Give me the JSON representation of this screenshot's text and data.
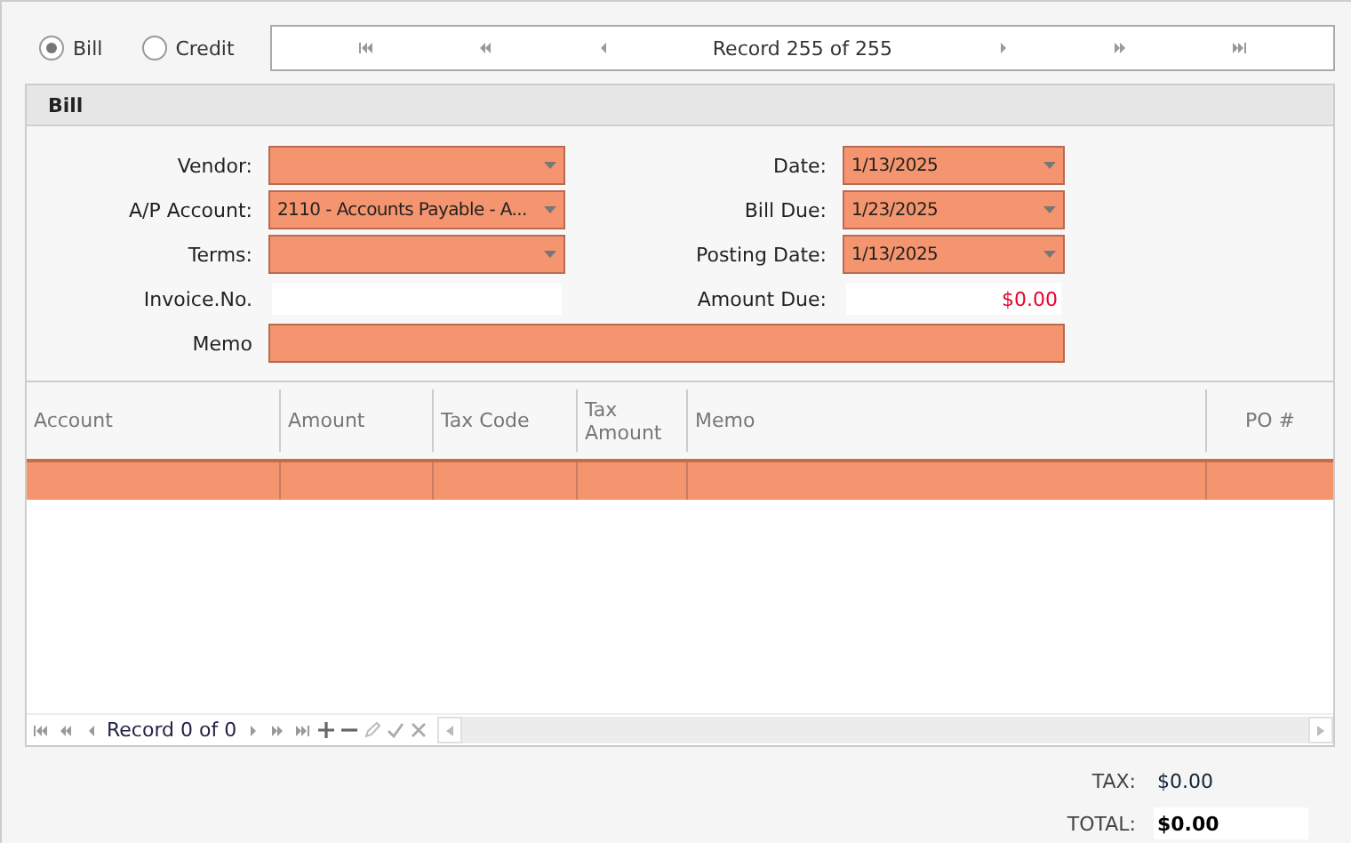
{
  "record_type": [
    {
      "label": "Bill",
      "selected": true
    },
    {
      "label": "Credit",
      "selected": false
    }
  ],
  "navigator": {
    "text": "Record 255 of 255"
  },
  "panel": {
    "title": "Bill"
  },
  "fields_left": [
    {
      "label": "Vendor:",
      "kind": "combo",
      "highlighted": true
    },
    {
      "label": "A/P Account:",
      "kind": "combo",
      "value": "2110 - Accounts Payable - A...",
      "highlighted": true
    },
    {
      "label": "Terms:",
      "kind": "combo",
      "highlighted": true
    },
    {
      "label": "Invoice.No.",
      "kind": "text",
      "highlighted": false
    }
  ],
  "fields_right": [
    {
      "label": "Date:",
      "kind": "combo",
      "value": "1/13/2025",
      "highlighted": true
    },
    {
      "label": "Bill Due:",
      "kind": "combo",
      "value": "1/23/2025",
      "highlighted": true
    },
    {
      "label": "Posting Date:",
      "kind": "combo",
      "value": "1/13/2025",
      "highlighted": true
    },
    {
      "label": "Amount Due:",
      "kind": "amount",
      "value": "$0.00",
      "highlighted": false
    }
  ],
  "memo": {
    "label": "Memo",
    "highlighted": true
  },
  "table": {
    "columns": [
      "Account",
      "Amount",
      "Tax Code",
      "Tax Amount",
      "Memo",
      "PO #"
    ],
    "rows": [
      {
        "selected": true
      }
    ]
  },
  "grid_navigator": {
    "text": "Record 0 of 0"
  },
  "totals": [
    {
      "label": "TAX:",
      "value": "$0.00",
      "kind": "plain"
    },
    {
      "label": "TOTAL:",
      "value": "$0.00",
      "kind": "boxed"
    }
  ]
}
